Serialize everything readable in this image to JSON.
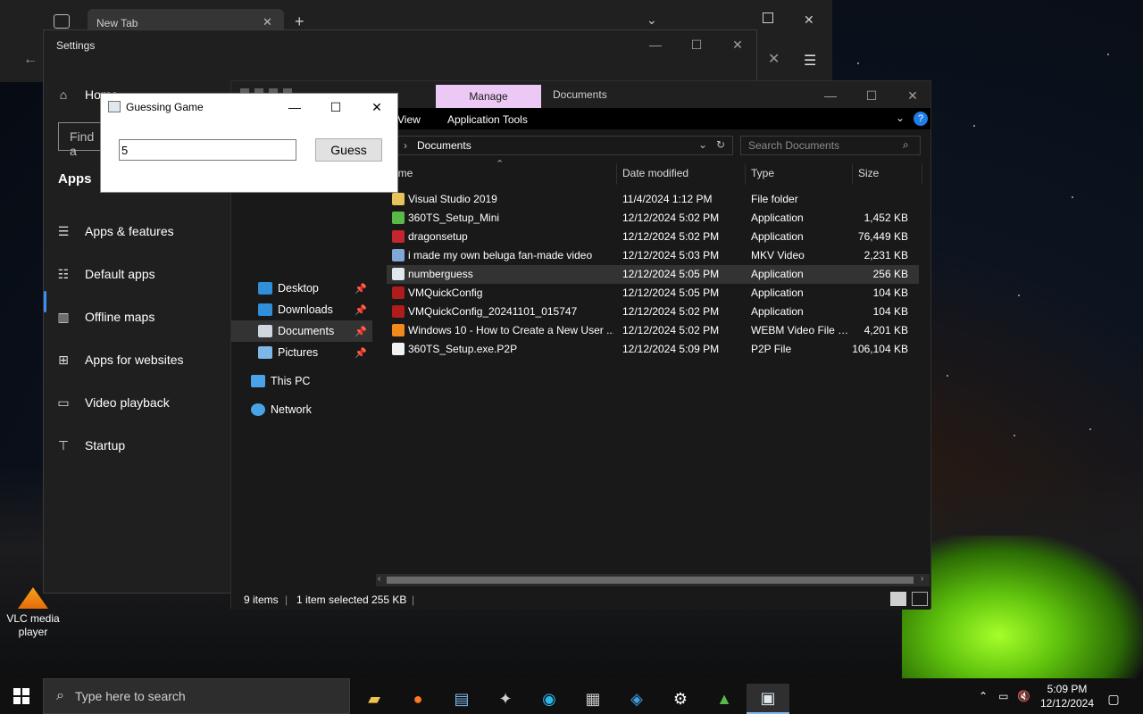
{
  "browser": {
    "tab_title": "New Tab"
  },
  "settings": {
    "title": "Settings",
    "home_label": "Home",
    "search_placeholder": "Find a",
    "section_label": "Apps",
    "nav": [
      {
        "label": "Apps & features",
        "icon": "list-icon"
      },
      {
        "label": "Default apps",
        "icon": "default-apps-icon"
      },
      {
        "label": "Offline maps",
        "icon": "map-icon"
      },
      {
        "label": "Apps for websites",
        "icon": "website-icon"
      },
      {
        "label": "Video playback",
        "icon": "video-icon"
      },
      {
        "label": "Startup",
        "icon": "startup-icon"
      }
    ]
  },
  "explorer": {
    "ribbon_context_tab": "Manage",
    "window_title": "Documents",
    "ribbon_tabs": [
      "View",
      "Application Tools"
    ],
    "address_path": "Documents",
    "search_placeholder": "Search Documents",
    "nav_pane": [
      {
        "label": "Desktop",
        "pinned": true,
        "color": "#2f8fd8"
      },
      {
        "label": "Downloads",
        "pinned": true,
        "color": "#2f8fd8"
      },
      {
        "label": "Documents",
        "pinned": true,
        "selected": true,
        "color": "#cfd6dd"
      },
      {
        "label": "Pictures",
        "pinned": true,
        "color": "#7db7e8"
      },
      {
        "label": "This PC",
        "pinned": false,
        "color": "#4aa3e6"
      },
      {
        "label": "Network",
        "pinned": false,
        "color": "#4aa3e6"
      }
    ],
    "columns": [
      "ame",
      "Date modified",
      "Type",
      "Size"
    ],
    "files": [
      {
        "name": "Visual Studio 2019",
        "date": "11/4/2024 1:12 PM",
        "type": "File folder",
        "size": "",
        "color": "#e8c25a"
      },
      {
        "name": "360TS_Setup_Mini",
        "date": "12/12/2024 5:02 PM",
        "type": "Application",
        "size": "1,452 KB",
        "color": "#58b948"
      },
      {
        "name": "dragonsetup",
        "date": "12/12/2024 5:02 PM",
        "type": "Application",
        "size": "76,449 KB",
        "color": "#c4262e"
      },
      {
        "name": "i made my own beluga fan-made video",
        "date": "12/12/2024 5:03 PM",
        "type": "MKV Video",
        "size": "2,231 KB",
        "color": "#7fa8d8"
      },
      {
        "name": "numberguess",
        "date": "12/12/2024 5:05 PM",
        "type": "Application",
        "size": "256 KB",
        "color": "#dfe7ef",
        "selected": true
      },
      {
        "name": "VMQuickConfig",
        "date": "12/12/2024 5:05 PM",
        "type": "Application",
        "size": "104 KB",
        "color": "#b01b1b"
      },
      {
        "name": "VMQuickConfig_20241101_015747",
        "date": "12/12/2024 5:02 PM",
        "type": "Application",
        "size": "104 KB",
        "color": "#b01b1b"
      },
      {
        "name": "Windows 10 - How to Create a New User ...",
        "date": "12/12/2024 5:02 PM",
        "type": "WEBM Video File (...",
        "size": "4,201 KB",
        "color": "#f08a1c"
      },
      {
        "name": "360TS_Setup.exe.P2P",
        "date": "12/12/2024 5:09 PM",
        "type": "P2P File",
        "size": "106,104 KB",
        "color": "#f2f2f2"
      }
    ],
    "status": {
      "items": "9 items",
      "selected": "1 item selected  255 KB"
    }
  },
  "game": {
    "title": "Guessing Game",
    "input_value": "5",
    "button_label": "Guess"
  },
  "desktop": {
    "vlc_label": "VLC media player"
  },
  "taskbar": {
    "search_placeholder": "Type here to search",
    "time": "5:09 PM",
    "date": "12/12/2024"
  }
}
